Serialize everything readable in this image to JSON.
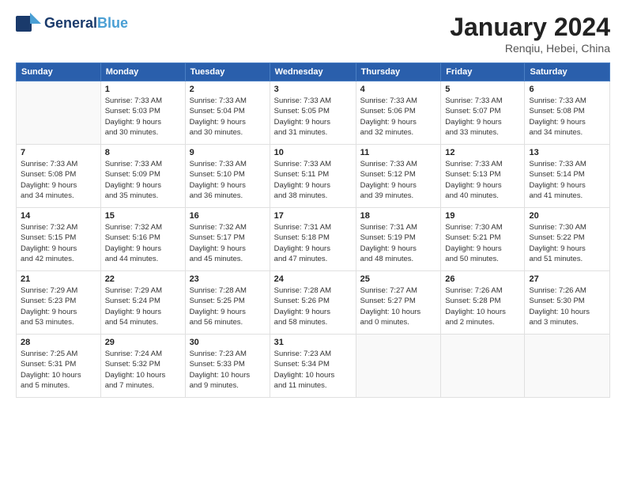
{
  "header": {
    "logo_general": "General",
    "logo_blue": "Blue",
    "month_title": "January 2024",
    "location": "Renqiu, Hebei, China"
  },
  "weekdays": [
    "Sunday",
    "Monday",
    "Tuesday",
    "Wednesday",
    "Thursday",
    "Friday",
    "Saturday"
  ],
  "weeks": [
    [
      {
        "day": "",
        "info": ""
      },
      {
        "day": "1",
        "info": "Sunrise: 7:33 AM\nSunset: 5:03 PM\nDaylight: 9 hours\nand 30 minutes."
      },
      {
        "day": "2",
        "info": "Sunrise: 7:33 AM\nSunset: 5:04 PM\nDaylight: 9 hours\nand 30 minutes."
      },
      {
        "day": "3",
        "info": "Sunrise: 7:33 AM\nSunset: 5:05 PM\nDaylight: 9 hours\nand 31 minutes."
      },
      {
        "day": "4",
        "info": "Sunrise: 7:33 AM\nSunset: 5:06 PM\nDaylight: 9 hours\nand 32 minutes."
      },
      {
        "day": "5",
        "info": "Sunrise: 7:33 AM\nSunset: 5:07 PM\nDaylight: 9 hours\nand 33 minutes."
      },
      {
        "day": "6",
        "info": "Sunrise: 7:33 AM\nSunset: 5:08 PM\nDaylight: 9 hours\nand 34 minutes."
      }
    ],
    [
      {
        "day": "7",
        "info": "Sunrise: 7:33 AM\nSunset: 5:08 PM\nDaylight: 9 hours\nand 34 minutes."
      },
      {
        "day": "8",
        "info": "Sunrise: 7:33 AM\nSunset: 5:09 PM\nDaylight: 9 hours\nand 35 minutes."
      },
      {
        "day": "9",
        "info": "Sunrise: 7:33 AM\nSunset: 5:10 PM\nDaylight: 9 hours\nand 36 minutes."
      },
      {
        "day": "10",
        "info": "Sunrise: 7:33 AM\nSunset: 5:11 PM\nDaylight: 9 hours\nand 38 minutes."
      },
      {
        "day": "11",
        "info": "Sunrise: 7:33 AM\nSunset: 5:12 PM\nDaylight: 9 hours\nand 39 minutes."
      },
      {
        "day": "12",
        "info": "Sunrise: 7:33 AM\nSunset: 5:13 PM\nDaylight: 9 hours\nand 40 minutes."
      },
      {
        "day": "13",
        "info": "Sunrise: 7:33 AM\nSunset: 5:14 PM\nDaylight: 9 hours\nand 41 minutes."
      }
    ],
    [
      {
        "day": "14",
        "info": "Sunrise: 7:32 AM\nSunset: 5:15 PM\nDaylight: 9 hours\nand 42 minutes."
      },
      {
        "day": "15",
        "info": "Sunrise: 7:32 AM\nSunset: 5:16 PM\nDaylight: 9 hours\nand 44 minutes."
      },
      {
        "day": "16",
        "info": "Sunrise: 7:32 AM\nSunset: 5:17 PM\nDaylight: 9 hours\nand 45 minutes."
      },
      {
        "day": "17",
        "info": "Sunrise: 7:31 AM\nSunset: 5:18 PM\nDaylight: 9 hours\nand 47 minutes."
      },
      {
        "day": "18",
        "info": "Sunrise: 7:31 AM\nSunset: 5:19 PM\nDaylight: 9 hours\nand 48 minutes."
      },
      {
        "day": "19",
        "info": "Sunrise: 7:30 AM\nSunset: 5:21 PM\nDaylight: 9 hours\nand 50 minutes."
      },
      {
        "day": "20",
        "info": "Sunrise: 7:30 AM\nSunset: 5:22 PM\nDaylight: 9 hours\nand 51 minutes."
      }
    ],
    [
      {
        "day": "21",
        "info": "Sunrise: 7:29 AM\nSunset: 5:23 PM\nDaylight: 9 hours\nand 53 minutes."
      },
      {
        "day": "22",
        "info": "Sunrise: 7:29 AM\nSunset: 5:24 PM\nDaylight: 9 hours\nand 54 minutes."
      },
      {
        "day": "23",
        "info": "Sunrise: 7:28 AM\nSunset: 5:25 PM\nDaylight: 9 hours\nand 56 minutes."
      },
      {
        "day": "24",
        "info": "Sunrise: 7:28 AM\nSunset: 5:26 PM\nDaylight: 9 hours\nand 58 minutes."
      },
      {
        "day": "25",
        "info": "Sunrise: 7:27 AM\nSunset: 5:27 PM\nDaylight: 10 hours\nand 0 minutes."
      },
      {
        "day": "26",
        "info": "Sunrise: 7:26 AM\nSunset: 5:28 PM\nDaylight: 10 hours\nand 2 minutes."
      },
      {
        "day": "27",
        "info": "Sunrise: 7:26 AM\nSunset: 5:30 PM\nDaylight: 10 hours\nand 3 minutes."
      }
    ],
    [
      {
        "day": "28",
        "info": "Sunrise: 7:25 AM\nSunset: 5:31 PM\nDaylight: 10 hours\nand 5 minutes."
      },
      {
        "day": "29",
        "info": "Sunrise: 7:24 AM\nSunset: 5:32 PM\nDaylight: 10 hours\nand 7 minutes."
      },
      {
        "day": "30",
        "info": "Sunrise: 7:23 AM\nSunset: 5:33 PM\nDaylight: 10 hours\nand 9 minutes."
      },
      {
        "day": "31",
        "info": "Sunrise: 7:23 AM\nSunset: 5:34 PM\nDaylight: 10 hours\nand 11 minutes."
      },
      {
        "day": "",
        "info": ""
      },
      {
        "day": "",
        "info": ""
      },
      {
        "day": "",
        "info": ""
      }
    ]
  ]
}
